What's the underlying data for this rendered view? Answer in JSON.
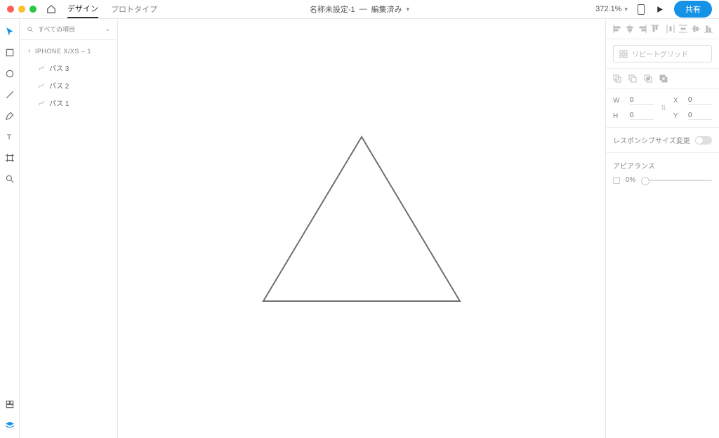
{
  "topbar": {
    "tabs": {
      "design": "デザイン",
      "prototype": "プロトタイプ"
    },
    "doc_name": "名称未設定-1",
    "doc_status": "編集済み",
    "zoom": "372.1%",
    "share_label": "共有"
  },
  "layers": {
    "search_placeholder": "すべての項目",
    "artboard": "IPHONE X/XS – 1",
    "items": [
      {
        "label": "パス 3"
      },
      {
        "label": "パス 2"
      },
      {
        "label": "パス 1"
      }
    ]
  },
  "inspector": {
    "repeat_grid_label": "リピートグリッド",
    "dims": {
      "w_label": "W",
      "w_value": "0",
      "h_label": "H",
      "h_value": "0",
      "x_label": "X",
      "x_value": "0",
      "y_label": "Y",
      "y_value": "0"
    },
    "responsive_label": "レスポンシブサイズ変更",
    "appearance_label": "アピアランス",
    "opacity_value": "0%"
  },
  "icons": {
    "search": "search-icon",
    "home": "home-icon",
    "device": "device-icon",
    "play": "play-icon",
    "chevron_down": "chevron-down-icon",
    "select": "select-tool-icon",
    "rect": "rectangle-tool-icon",
    "ellipse": "ellipse-tool-icon",
    "line": "line-tool-icon",
    "pen": "pen-tool-icon",
    "text": "text-tool-icon",
    "artboard": "artboard-tool-icon",
    "zoom": "zoom-tool-icon",
    "assets": "assets-icon",
    "layersIco": "layers-icon",
    "lock": "lock-icon",
    "grid": "grid-icon",
    "checkbox": "checkbox-icon"
  }
}
